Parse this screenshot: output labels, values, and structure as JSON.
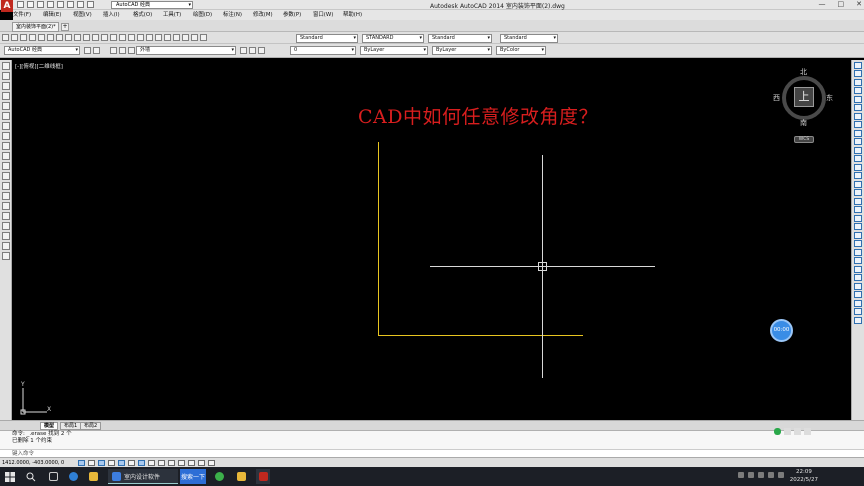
{
  "app": {
    "logo_letter": "A",
    "title": "Autodesk AutoCAD 2014    室内装饰平面(2).dwg",
    "workspace_small": "AutoCAD 经典",
    "window_controls": [
      "—",
      "□",
      "✕"
    ]
  },
  "menu": [
    "文件(F)",
    "编辑(E)",
    "视图(V)",
    "插入(I)",
    "格式(O)",
    "工具(T)",
    "绘图(D)",
    "标注(N)",
    "修改(M)",
    "参数(P)",
    "窗口(W)",
    "帮助(H)"
  ],
  "document": {
    "tab_label": "室内装饰平面(2)*",
    "new_tab": "+"
  },
  "toolbar2": {
    "workspace": "AutoCAD 经典",
    "layer": "外墙",
    "layer2": "0",
    "text_style": "Standard",
    "dim_style": "STANDARD",
    "table_style": "Standard",
    "mleader_style": "Standard",
    "linetype": "ByLayer",
    "lineweight": "ByLayer",
    "color": "ByColor"
  },
  "viewport": {
    "label": "[-][俯视][二维线框]",
    "overlay_title": "CAD中如何任意修改角度？",
    "recording_timer": "00:00"
  },
  "viewcube": {
    "north": "北",
    "south": "南",
    "east": "东",
    "west": "西",
    "face": "上",
    "wcs": "WCS"
  },
  "ucs": {
    "x": "X",
    "y": "Y"
  },
  "layout_tabs": [
    "模型",
    "布局1",
    "布局2"
  ],
  "command": {
    "line1": "命令: _.erase 找到 2 个",
    "line2": "已删除 1 个约束",
    "prompt": "键入命令"
  },
  "status": {
    "coordinates": "1412.0000, -403.0000, 0"
  },
  "taskbar": {
    "app_label": "室内设计软件",
    "button_label": "搜索一下",
    "time": "22:09",
    "date": "2022/5/27"
  },
  "colors": {
    "overlay_title": "#d81e1e",
    "l_shape": "#e6c200",
    "crosshair": "#d8d8d8",
    "canvas": "#000000",
    "timer_button": "#3a8de6"
  },
  "icons": {
    "sogou": "sogou-ime-icon",
    "start": "windows-logo-icon",
    "search": "search-icon"
  }
}
